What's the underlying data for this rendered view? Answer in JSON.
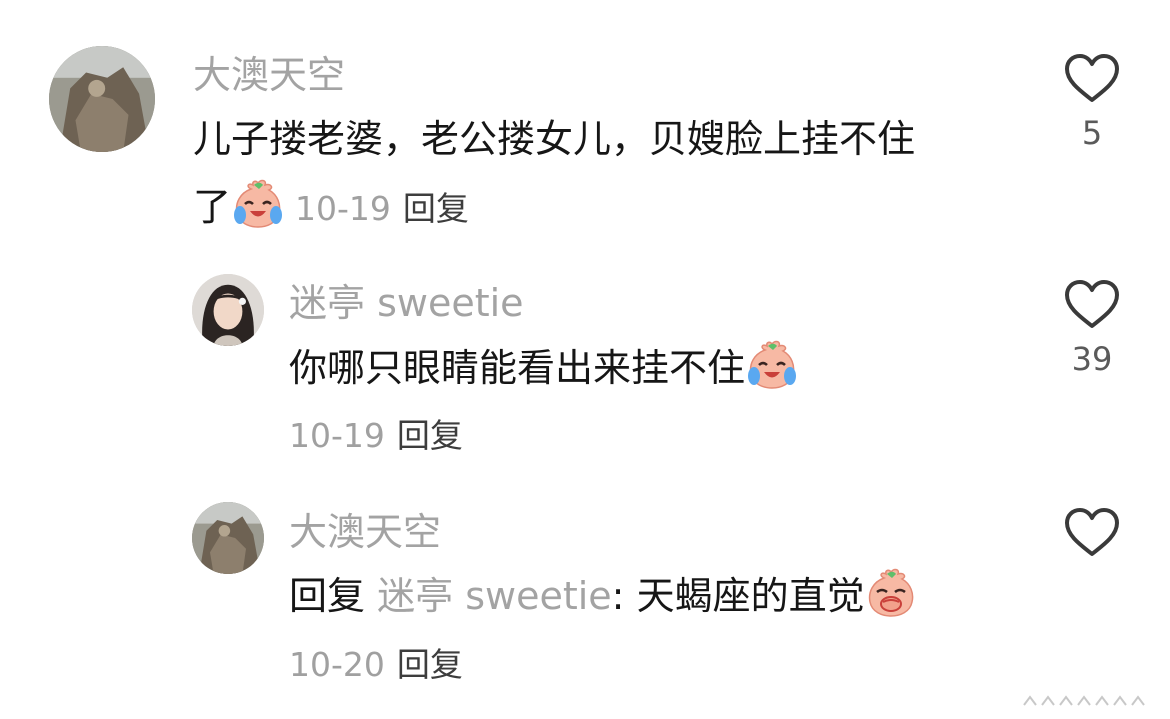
{
  "comments": [
    {
      "username": "大澳天空",
      "text_line1": "儿子搂老婆，老公搂女儿，贝嫂脸上挂不住",
      "text_line2": "了",
      "emoji": "laughing-crying-peach-emoji",
      "date": "10-19",
      "reply_label": "回复",
      "like_count": "5"
    },
    {
      "username": "迷亭 sweetie",
      "text": "你哪只眼睛能看出来挂不住",
      "emoji": "laughing-crying-peach-emoji",
      "date": "10-19",
      "reply_label": "回复",
      "like_count": "39"
    },
    {
      "username": "大澳天空",
      "reply_prefix": "回复",
      "reply_to": "迷亭 sweetie",
      "reply_sep": ": ",
      "text": "天蝎座的直觉",
      "emoji": "giggling-peach-emoji",
      "date": "10-20",
      "reply_label": "回复"
    }
  ]
}
